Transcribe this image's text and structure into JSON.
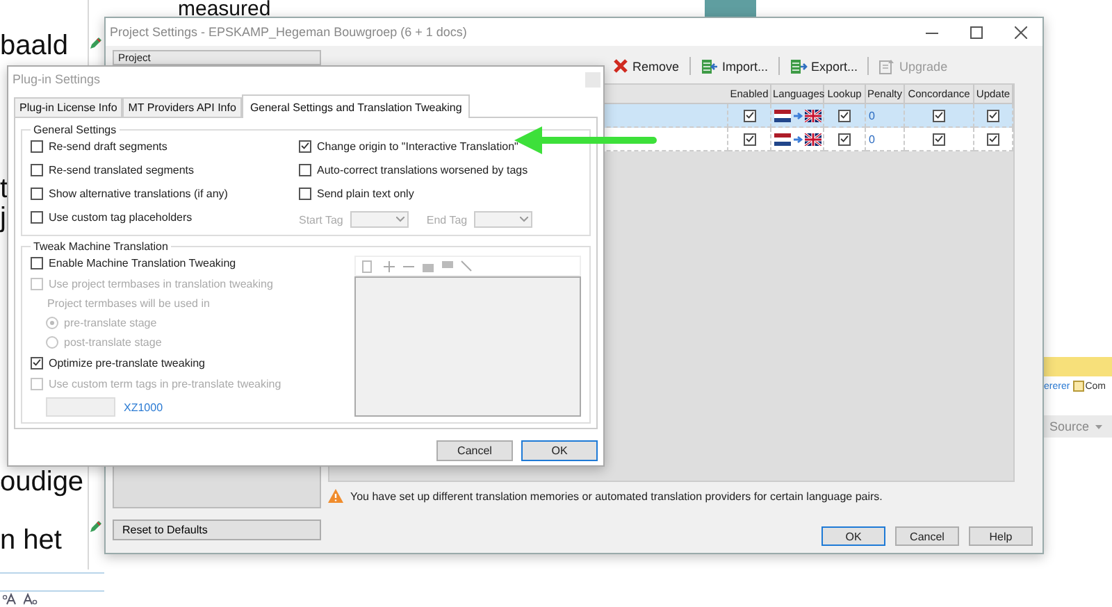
{
  "background": {
    "top_text": "measured",
    "left_texts": [
      "baald",
      "t",
      "j",
      "oudige",
      "n het"
    ],
    "side_link": "ererer",
    "side_tab": "Com",
    "source_label": "Source"
  },
  "project_settings": {
    "title": "Project Settings - EPSKAMP_Hegeman Bouwgroep (6 + 1 docs)",
    "tree_header": "Project",
    "toolbar": [
      {
        "kind": "remove",
        "label": "Remove",
        "disabled": false
      },
      {
        "kind": "import",
        "label": "Import...",
        "disabled": false
      },
      {
        "kind": "export",
        "label": "Export...",
        "disabled": false
      },
      {
        "kind": "upgrade",
        "label": "Upgrade",
        "disabled": true
      }
    ],
    "table": {
      "columns": [
        "Enabled",
        "Languages",
        "Lookup",
        "Penalty",
        "Concordance",
        "Update"
      ],
      "rows": [
        {
          "selected": true,
          "enabled": true,
          "lookup": true,
          "penalty": "0",
          "concordance": true,
          "update": true
        },
        {
          "selected": false,
          "enabled": true,
          "lookup": true,
          "penalty": "0",
          "concordance": true,
          "update": true
        }
      ]
    },
    "warning": "You have set up different translation memories or automated translation providers for certain language pairs.",
    "reset_button": "Reset to Defaults",
    "buttons": [
      {
        "label": "OK",
        "default": true
      },
      {
        "label": "Cancel",
        "default": false
      },
      {
        "label": "Help",
        "default": false
      }
    ]
  },
  "plugin_settings": {
    "title": "Plug-in Settings",
    "tabs": [
      {
        "label": "Plug-in License Info",
        "selected": false
      },
      {
        "label": "MT Providers API Info",
        "selected": false
      },
      {
        "label": "General Settings and Translation Tweaking",
        "selected": true
      }
    ],
    "general": {
      "title": "General Settings",
      "left": [
        {
          "label": "Re-send draft segments",
          "checked": false,
          "disabled": false
        },
        {
          "label": "Re-send translated segments",
          "checked": false,
          "disabled": false
        },
        {
          "label": "Show alternative translations (if any)",
          "checked": false,
          "disabled": false
        },
        {
          "label": "Use custom tag placeholders",
          "checked": false,
          "disabled": false
        }
      ],
      "right": [
        {
          "label": "Change origin to \"Interactive Translation\"",
          "checked": true,
          "disabled": false
        },
        {
          "label": "Auto-correct translations worsened by tags",
          "checked": false,
          "disabled": false
        },
        {
          "label": "Send plain text only",
          "checked": false,
          "disabled": false
        }
      ],
      "start_tag": "Start Tag",
      "end_tag": "End Tag",
      "tags_disabled": true
    },
    "tweak": {
      "title": "Tweak Machine Translation",
      "items": [
        {
          "kind": "checkbox",
          "label": "Enable Machine Translation Tweaking",
          "checked": false,
          "disabled": false
        },
        {
          "kind": "checkbox",
          "label": "Use project termbases in translation tweaking",
          "checked": false,
          "disabled": true
        },
        {
          "kind": "note",
          "label": "Project termbases will be used in",
          "disabled": true
        },
        {
          "kind": "radio",
          "label": "pre-translate stage",
          "selected": true,
          "disabled": true
        },
        {
          "kind": "radio",
          "label": "post-translate stage",
          "selected": false,
          "disabled": true
        },
        {
          "kind": "checkbox",
          "label": "Optimize pre-translate tweaking",
          "checked": true,
          "disabled": false
        },
        {
          "kind": "checkbox",
          "label": "Use custom term tags in pre-translate tweaking",
          "checked": false,
          "disabled": true
        },
        {
          "kind": "term_tags",
          "link": "XZ1000"
        }
      ]
    },
    "buttons": [
      {
        "label": "Cancel",
        "default": false
      },
      {
        "label": "OK",
        "default": true
      }
    ]
  }
}
